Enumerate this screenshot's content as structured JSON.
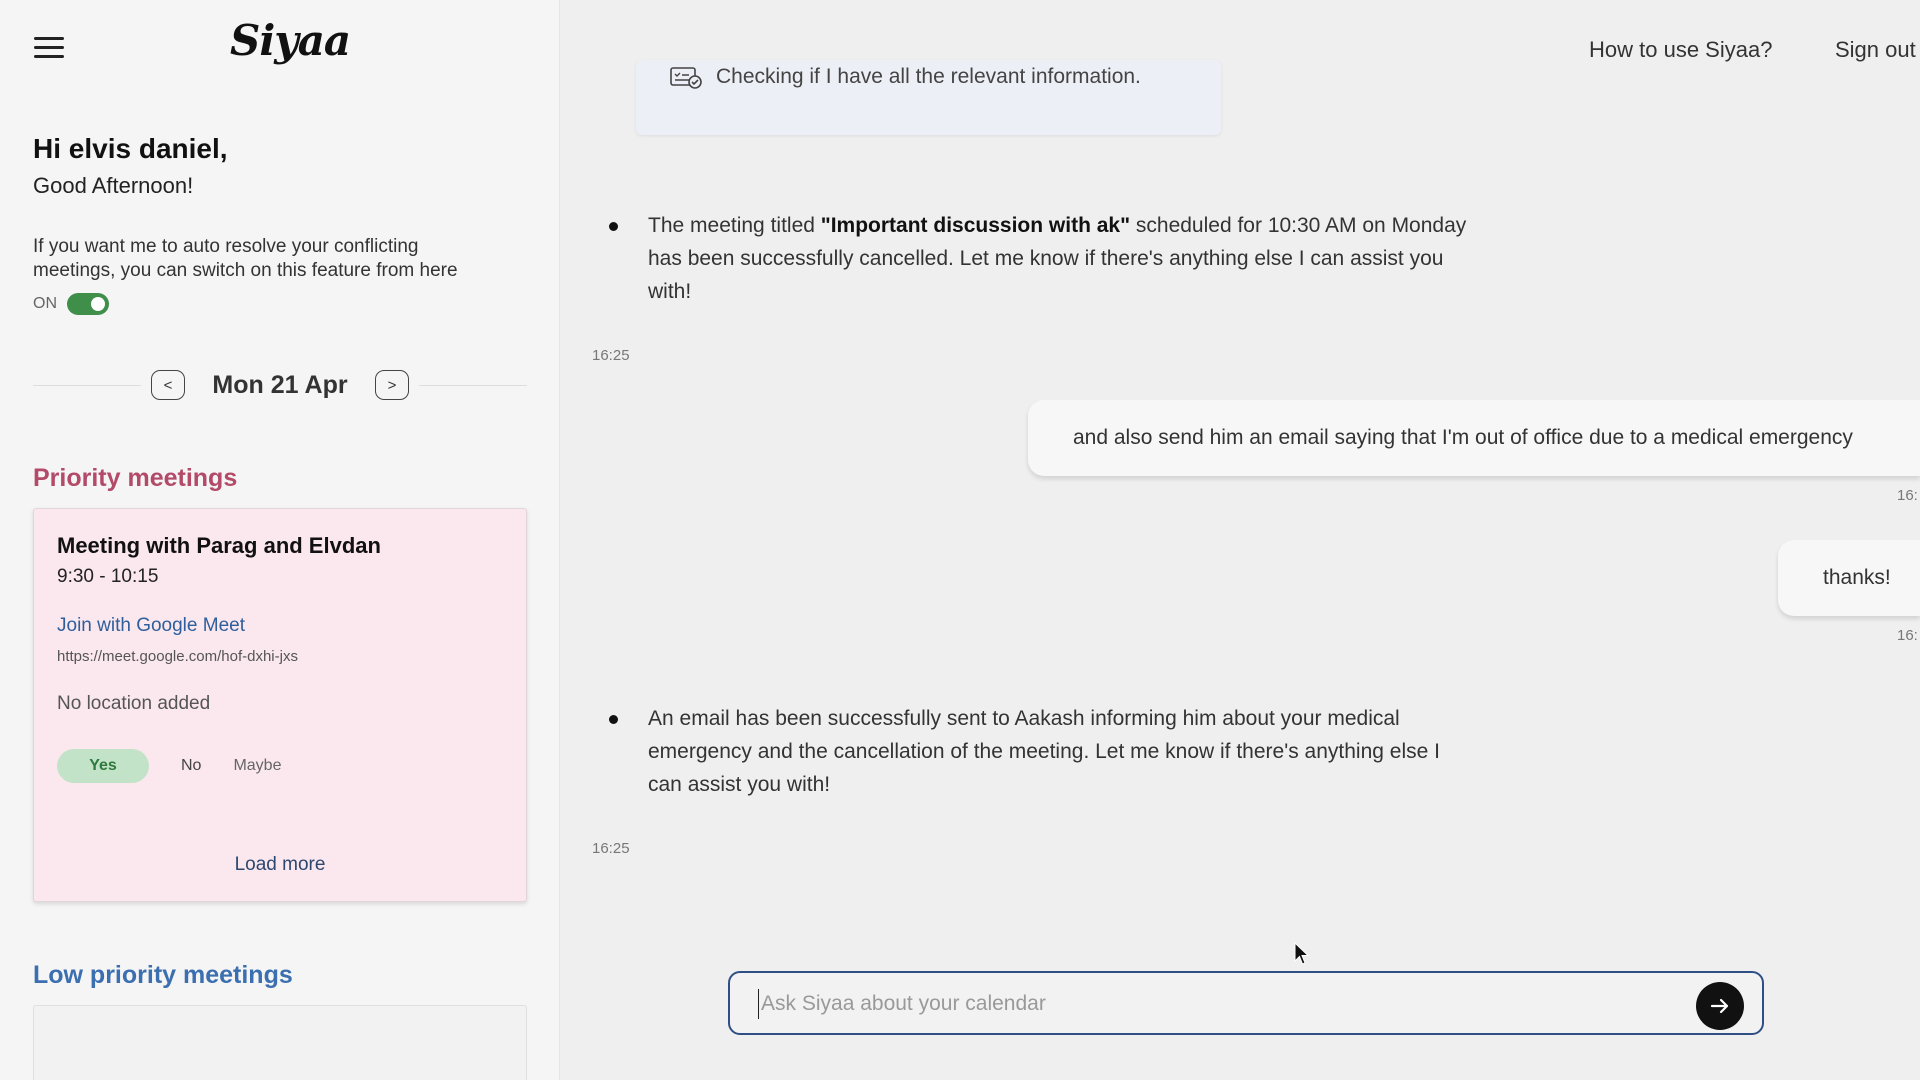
{
  "sidebar": {
    "logo": "Siyaa",
    "greeting": "Hi elvis daniel,",
    "subgreeting": "Good Afternoon!",
    "auto_resolve_text": "If you want me to auto resolve your conflicting meetings, you can switch on this feature from here",
    "toggle_label": "ON",
    "toggle_state": "on",
    "date": "Mon 21 Apr",
    "prev_label": "<",
    "next_label": ">",
    "priority_title": "Priority meetings",
    "low_priority_title": "Low priority meetings",
    "meeting": {
      "title": "Meeting with Parag and Elvdan",
      "time": "9:30 - 10:15",
      "join_label": "Join with Google Meet",
      "url": "https://meet.google.com/hof-dxhi-jxs",
      "location": "No location added",
      "rsvp_yes": "Yes",
      "rsvp_no": "No",
      "rsvp_maybe": "Maybe"
    },
    "load_more": "Load more"
  },
  "header": {
    "how_to": "How to use Siyaa?",
    "sign_out": "Sign out"
  },
  "chat": {
    "checking_text": "Checking if I have all the relevant information.",
    "msg1_before": "The meeting titled ",
    "msg1_bold": "\"Important discussion with ak\"",
    "msg1_after": " scheduled for 10:30 AM on Monday has been successfully cancelled. Let me know if there's anything else I can assist you with!",
    "msg1_time": "16:25",
    "user1": "and also send him an email saying that I'm out of office due to a medical emergency",
    "user1_time": "16:",
    "user2": "thanks!",
    "user2_time": "16:",
    "msg2": "An email has been successfully sent to Aakash informing him about your medical emergency and the cancellation of the meeting. Let me know if there's anything else I can assist you with!",
    "msg2_time": "16:25",
    "input_placeholder": "Ask Siyaa about your calendar"
  },
  "colors": {
    "priority": "#b24a68",
    "low_priority": "#3b6fb0",
    "toggle_on": "#3f8f4a",
    "input_border": "#2e4f86"
  }
}
